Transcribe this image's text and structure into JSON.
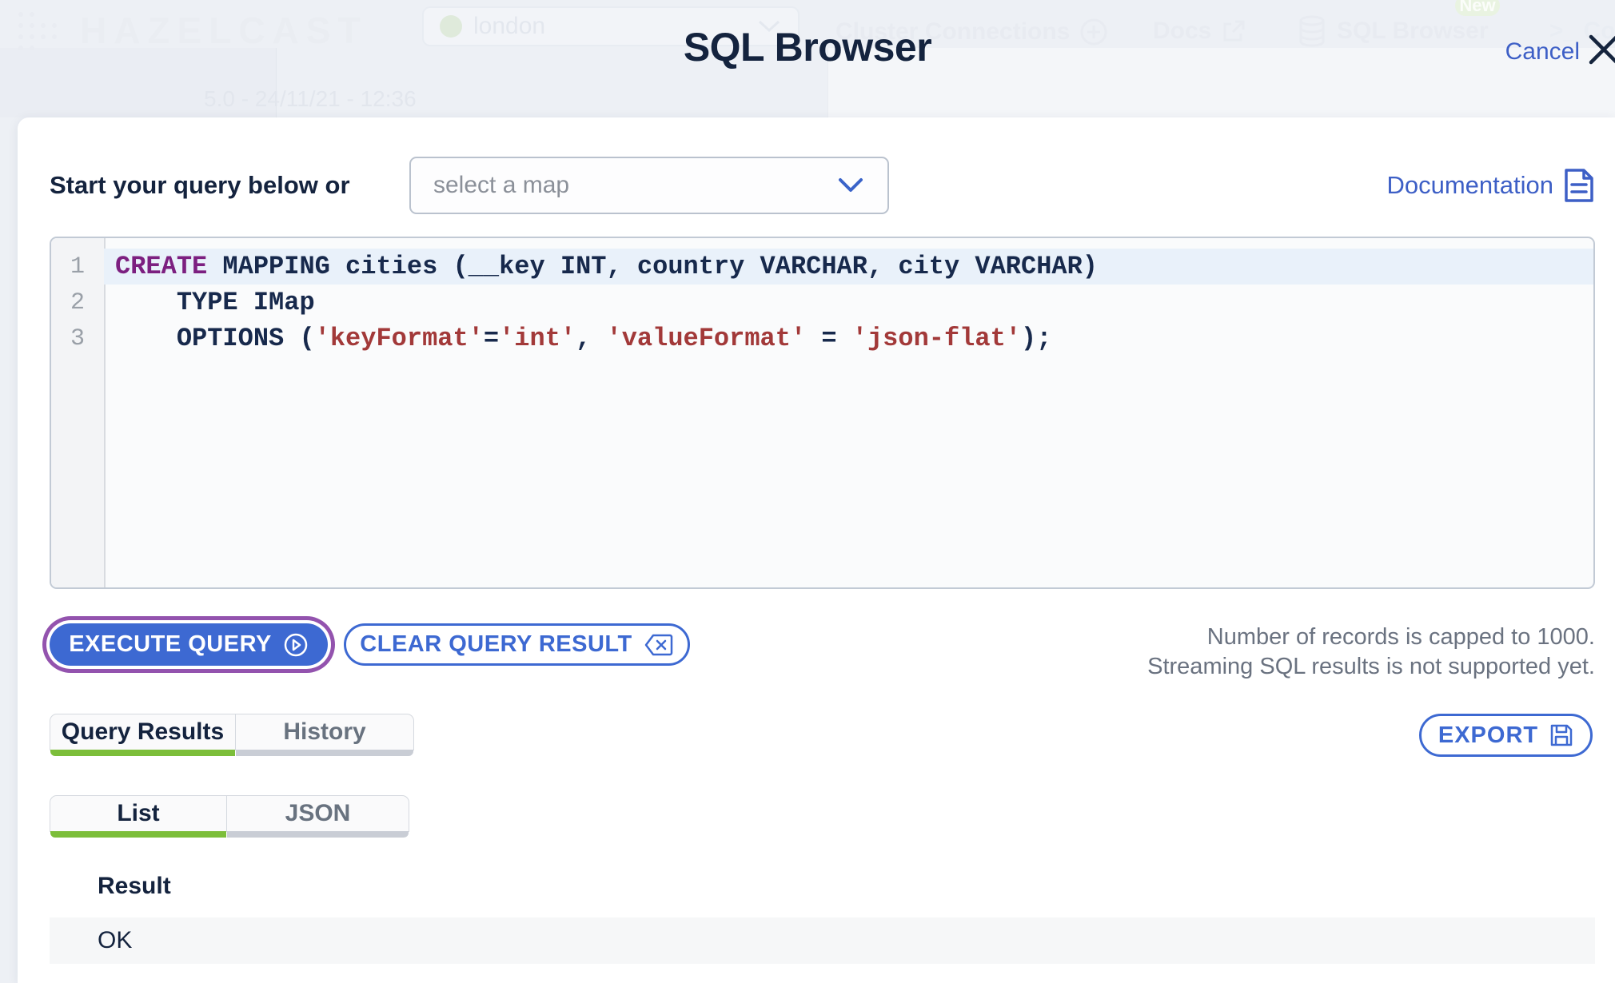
{
  "colors": {
    "accent_blue": "#3d69d2",
    "link_blue": "#3d5fc6",
    "focus_ring_purple": "#9353ae",
    "active_tab_green": "#7cbe3a",
    "title_navy": "#14233e",
    "code_keyword": "#7c1f80",
    "code_string": "#a23939",
    "overlay_background": "#edf0f5"
  },
  "background_app": {
    "logo_text": "HAZELCAST",
    "cluster_name": "london",
    "nav_cluster_connections": "Cluster Connections",
    "nav_docs": "Docs",
    "nav_sql_browser": "SQL Browser",
    "nav_new_badge": "New",
    "nav_console_partial": "Co",
    "version_text": "5.0 - 24/11/21 - 12:36"
  },
  "modal": {
    "title": "SQL Browser",
    "cancel_label": "Cancel",
    "prompt": "Start your query below or",
    "map_select": {
      "placeholder": "select a map"
    },
    "documentation_label": "Documentation",
    "editor": {
      "lines": [
        {
          "number": "1",
          "active": true,
          "segments": [
            {
              "t": "CREATE",
              "c": "kw"
            },
            {
              "t": " MAPPING cities (__key INT, country VARCHAR, city VARCHAR)",
              "c": "pl"
            }
          ]
        },
        {
          "number": "2",
          "active": false,
          "segments": [
            {
              "t": "    TYPE IMap",
              "c": "pl"
            }
          ]
        },
        {
          "number": "3",
          "active": false,
          "segments": [
            {
              "t": "    OPTIONS (",
              "c": "pl"
            },
            {
              "t": "'keyFormat'",
              "c": "str"
            },
            {
              "t": "=",
              "c": "pl"
            },
            {
              "t": "'int'",
              "c": "str"
            },
            {
              "t": ", ",
              "c": "pl"
            },
            {
              "t": "'valueFormat'",
              "c": "str"
            },
            {
              "t": " = ",
              "c": "pl"
            },
            {
              "t": "'json-flat'",
              "c": "str"
            },
            {
              "t": ");",
              "c": "pl"
            }
          ]
        }
      ]
    },
    "execute_label": "EXECUTE QUERY",
    "clear_label": "CLEAR QUERY RESULT",
    "note_lines": [
      "Number of records is capped to 1000.",
      "Streaming SQL results is not supported yet."
    ],
    "result_tabs": [
      {
        "label": "Query Results",
        "active": true
      },
      {
        "label": "History",
        "active": false
      }
    ],
    "export_label": "EXPORT",
    "view_tabs": [
      {
        "label": "List",
        "active": true
      },
      {
        "label": "JSON",
        "active": false
      }
    ],
    "results": {
      "column_header": "Result",
      "rows": [
        "OK"
      ]
    }
  }
}
